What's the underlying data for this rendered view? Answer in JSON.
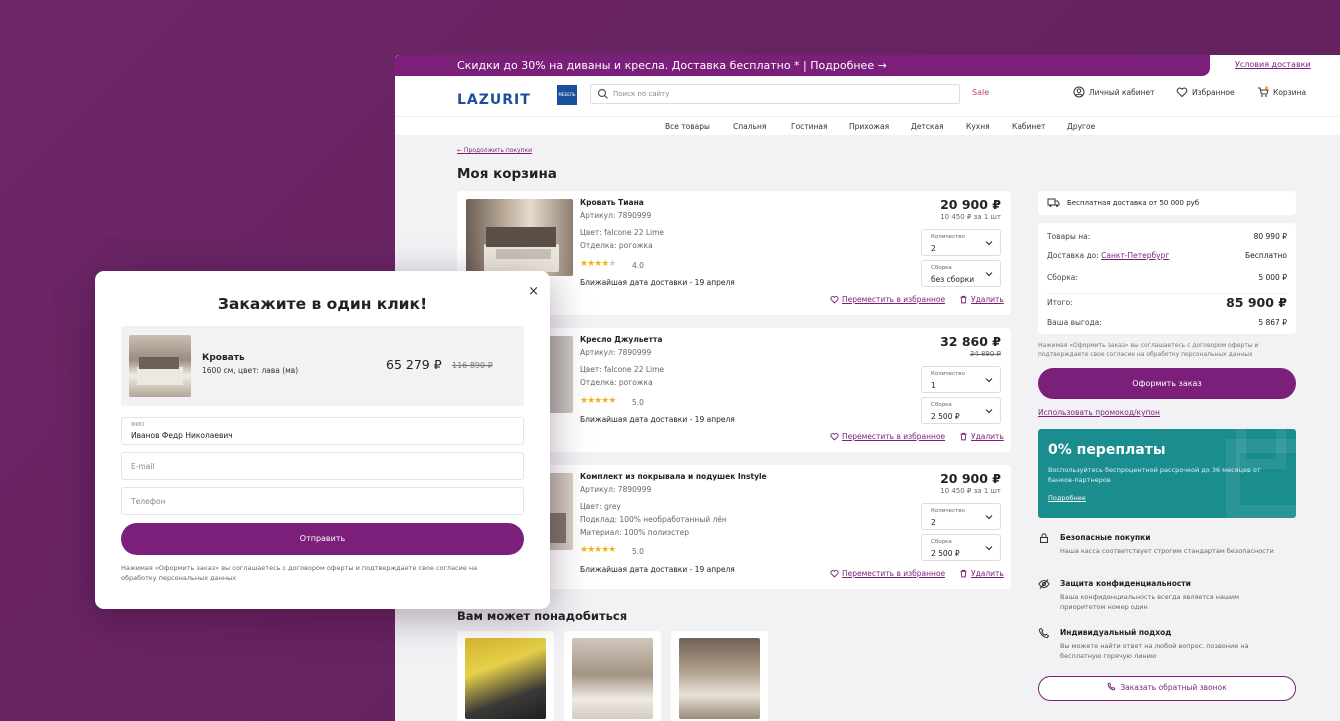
{
  "promo": {
    "text": "Скидки до 30% на диваны и кресла. Доставка бесплатно * | Подробнее →",
    "link": "Условия доставки"
  },
  "header": {
    "logo": "LAZURIT",
    "logo_sub": "МЕБЕЛЬ",
    "search_placeholder": "Поиск по сайту",
    "sale": "Sale",
    "account": "Личный кабинет",
    "favorites": "Избранное",
    "cart": "Корзина"
  },
  "nav": [
    "Все товары",
    "Спальня",
    "Гостиная",
    "Прихожая",
    "Детская",
    "Кухня",
    "Кабинет",
    "Другое"
  ],
  "back_link": "← Продолжить покупки",
  "page_title": "Моя корзина",
  "items": [
    {
      "name": "Кровать Тиана",
      "article": "Артикул: 7890999",
      "attr1": "Цвет: falcone 22 Lime",
      "attr2": "Отделка: рогожка",
      "rating": "4.0",
      "stars": 4,
      "delivery": "Ближайшая дата доставки - 19 апреля",
      "price": "20 900 ₽",
      "sub": "10 450 ₽ за 1 шт",
      "qty_label": "Количество",
      "qty": "2",
      "asm_label": "Сборка",
      "asm": "без сборки",
      "fav": "Переместить в избранное",
      "del": "Удалить"
    },
    {
      "name": "Кресло Джульетта",
      "article": "Артикул: 7890999",
      "attr1": "Цвет: falcone 22 Lime",
      "attr2": "Отделка: рогожка",
      "rating": "5.0",
      "stars": 5,
      "delivery": "Ближайшая дата доставки - 19 апреля",
      "price": "32 860 ₽",
      "sub": "34 890 ₽",
      "qty_label": "Количество",
      "qty": "1",
      "asm_label": "Сборка",
      "asm": "2 500 ₽",
      "fav": "Переместить в избранное",
      "del": "Удалить"
    },
    {
      "name": "Комплект из покрывала и подушек Instyle",
      "article": "Артикул: 7890999",
      "attr1": "Цвет: grey",
      "attr2": "Подклад: 100% необработанный лён",
      "attr3": "Материал: 100% полиэстер",
      "rating": "5.0",
      "stars": 5,
      "delivery": "Ближайшая дата доставки - 19 апреля",
      "price": "20 900 ₽",
      "sub": "10 450 ₽ за 1 шт",
      "qty_label": "Количество",
      "qty": "2",
      "asm_label": "Сборка",
      "asm": "2 500 ₽",
      "fav": "Переместить в избранное",
      "del": "Удалить"
    }
  ],
  "maybe_title": "Вам может понадобиться",
  "sidebar": {
    "free_shipping": "Бесплатная доставка от 50 000 руб",
    "goods_label": "Товары на:",
    "goods_value": "80 990 ₽",
    "delivery_label": "Доставка до:",
    "delivery_city": "Санкт-Петербург",
    "delivery_value": "Бесплатно",
    "assembly_label": "Сборка:",
    "assembly_value": "5 000 ₽",
    "total_label": "Итого:",
    "total_value": "85 900 ₽",
    "benefit_label": "Ваша выгода:",
    "benefit_value": "5 867 ₽",
    "note": "Нажимая «Оформить заказ» вы соглашаетесь с договором оферты и подтверждаете свое согласие на обработку персональных данных",
    "order_button": "Оформить заказ",
    "promo_link": "Использовать промокод/купон",
    "installment_title": "0% переплаты",
    "installment_text": "Воспользуйтесь беспроцентной рассрочкой до 36 месяцев от банков-партнеров",
    "installment_link": "Подробнее",
    "features": [
      {
        "title": "Безопасные покупки",
        "text": "Наша касса соответствует строгим стандартам безопасности"
      },
      {
        "title": "Защита конфиденциальности",
        "text": "Ваша конфиденциальность всегда является нашим приоритетом номер один"
      },
      {
        "title": "Индивидуальный подход",
        "text": "Вы можете найти ответ на любой вопрос, позвоние на бесплатную горячую линию"
      }
    ],
    "callback_button": "Заказать обратный звонок"
  },
  "modal": {
    "title": "Закажите в один клик!",
    "close": "×",
    "product_name": "Кровать",
    "product_desc": "1600 см, цвет: лава (мв)",
    "price": "65 279 ₽",
    "old_price": "116 890 ₽",
    "fio_label": "ФИО",
    "fio_value": "Иванов Федр Николаевич",
    "email_placeholder": "E-mail",
    "phone_placeholder": "Телефон",
    "submit": "Отправить",
    "note": "Нажимая «Оформить заказ» вы соглашаетесь с договором оферты и подтверждаете свое согласие на обработку персональных данных"
  },
  "colors": {
    "accent": "#7b1f7b",
    "background": "#682363",
    "teal": "#1a8d8e",
    "star": "#f2b218"
  }
}
